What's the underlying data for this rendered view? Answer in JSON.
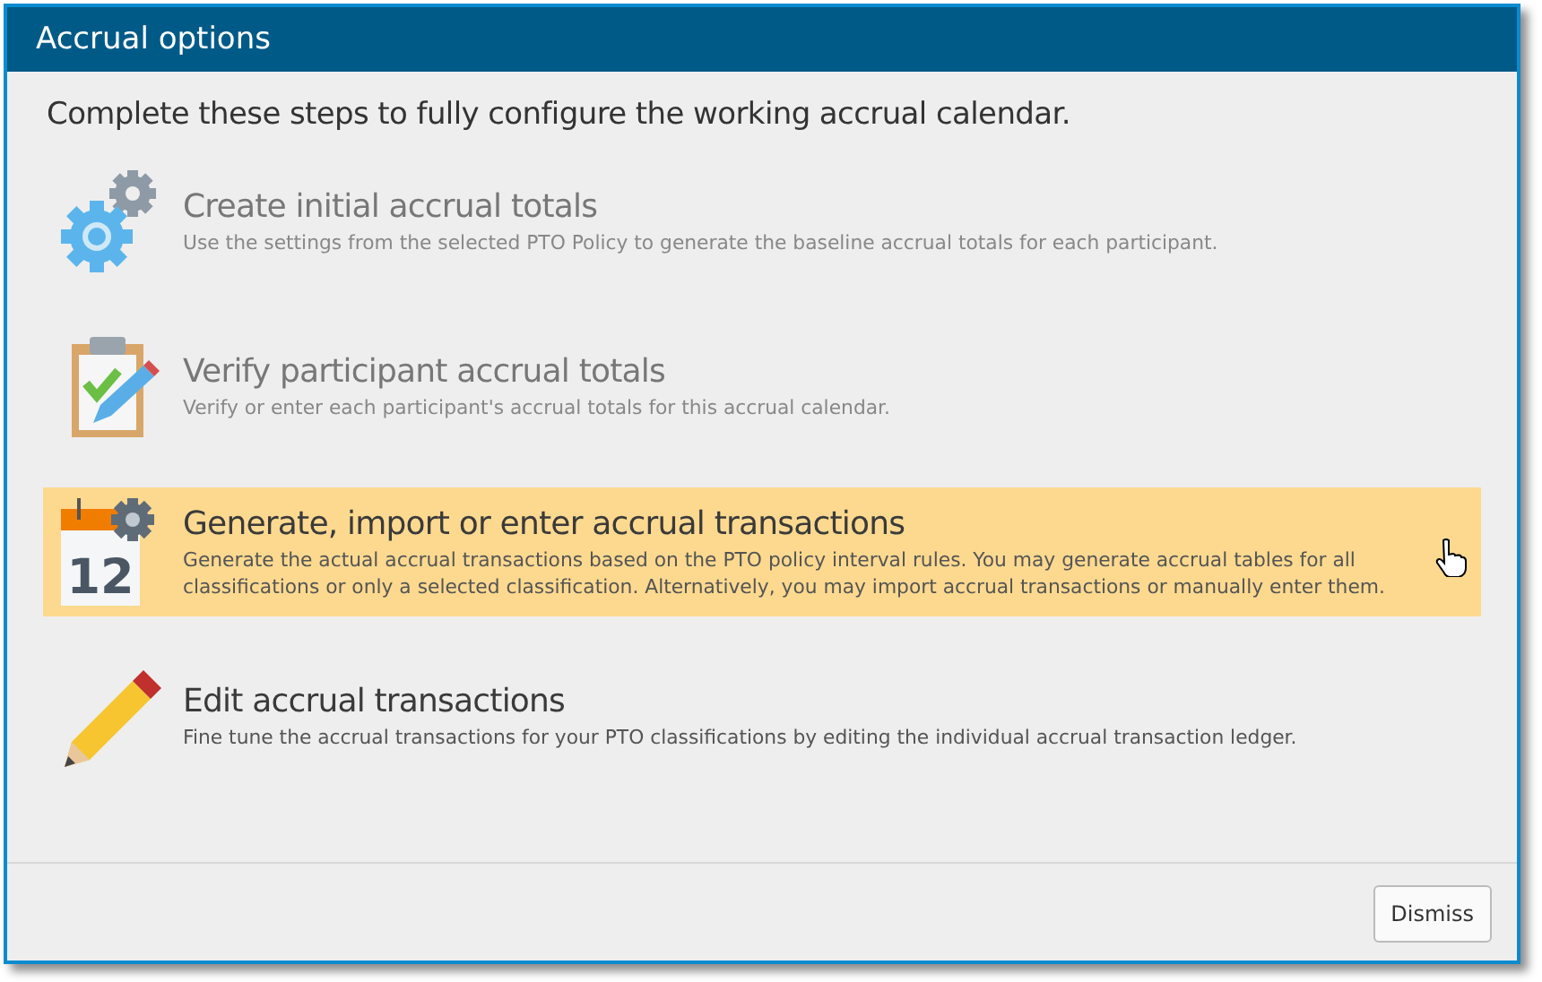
{
  "window": {
    "title": "Accrual options"
  },
  "intro": "Complete these steps to fully configure the working accrual calendar.",
  "steps": [
    {
      "kind": "gears",
      "title": "Create initial accrual totals",
      "description": "Use the settings from the selected PTO Policy to generate the baseline accrual totals for each participant.",
      "disabled": true,
      "selected": false
    },
    {
      "kind": "clipboard",
      "title": "Verify participant accrual totals",
      "description": "Verify or enter each participant's accrual totals for this accrual calendar.",
      "disabled": true,
      "selected": false
    },
    {
      "kind": "calendar",
      "icon_text": "12",
      "title": "Generate, import or enter accrual transactions",
      "description": "Generate the actual accrual transactions based on the PTO policy interval rules. You may generate accrual tables for all classifications or only a selected classification. Alternatively, you may import accrual transactions or manually enter them.",
      "disabled": false,
      "selected": true
    },
    {
      "kind": "pencil",
      "title": "Edit accrual transactions",
      "description": "Fine tune the accrual transactions for your PTO classifications by editing the individual accrual transaction ledger.",
      "disabled": false,
      "selected": false
    }
  ],
  "buttons": [
    "Dismiss"
  ]
}
